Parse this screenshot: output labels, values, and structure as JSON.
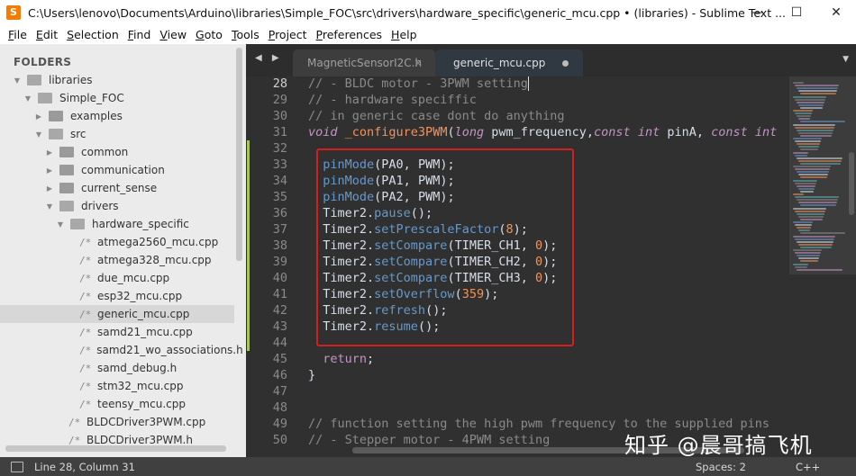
{
  "window": {
    "title": "C:\\Users\\lenovo\\Documents\\Arduino\\libraries\\Simple_FOC\\src\\drivers\\hardware_specific\\generic_mcu.cpp • (libraries) - Sublime Text ...",
    "minimize": "—",
    "maximize": "☐",
    "close": "✕",
    "app_icon": "S"
  },
  "menu": [
    "File",
    "Edit",
    "Selection",
    "Find",
    "View",
    "Goto",
    "Tools",
    "Project",
    "Preferences",
    "Help"
  ],
  "sidebar": {
    "title": "FOLDERS",
    "items": [
      {
        "label": "libraries",
        "kind": "folder",
        "open": true,
        "depth": 1
      },
      {
        "label": "Simple_FOC",
        "kind": "folder",
        "open": true,
        "depth": 2
      },
      {
        "label": "examples",
        "kind": "folder",
        "open": false,
        "depth": 3
      },
      {
        "label": "src",
        "kind": "folder",
        "open": true,
        "depth": 3
      },
      {
        "label": "common",
        "kind": "folder",
        "open": false,
        "depth": 4
      },
      {
        "label": "communication",
        "kind": "folder",
        "open": false,
        "depth": 4
      },
      {
        "label": "current_sense",
        "kind": "folder",
        "open": false,
        "depth": 4
      },
      {
        "label": "drivers",
        "kind": "folder",
        "open": true,
        "depth": 4
      },
      {
        "label": "hardware_specific",
        "kind": "folder",
        "open": true,
        "depth": 5
      },
      {
        "label": "atmega2560_mcu.cpp",
        "kind": "file",
        "depth": 6
      },
      {
        "label": "atmega328_mcu.cpp",
        "kind": "file",
        "depth": 6
      },
      {
        "label": "due_mcu.cpp",
        "kind": "file",
        "depth": 6
      },
      {
        "label": "esp32_mcu.cpp",
        "kind": "file",
        "depth": 6
      },
      {
        "label": "generic_mcu.cpp",
        "kind": "file",
        "depth": 6,
        "selected": true
      },
      {
        "label": "samd21_mcu.cpp",
        "kind": "file",
        "depth": 6
      },
      {
        "label": "samd21_wo_associations.h",
        "kind": "file",
        "depth": 6
      },
      {
        "label": "samd_debug.h",
        "kind": "file",
        "depth": 6
      },
      {
        "label": "stm32_mcu.cpp",
        "kind": "file",
        "depth": 6
      },
      {
        "label": "teensy_mcu.cpp",
        "kind": "file",
        "depth": 6
      },
      {
        "label": "BLDCDriver3PWM.cpp",
        "kind": "file",
        "depth": 5
      },
      {
        "label": "BLDCDriver3PWM.h",
        "kind": "file",
        "depth": 5
      }
    ],
    "file_glyph": "/*"
  },
  "tabs": {
    "nav": "◀ ▶",
    "items": [
      {
        "label": "MagneticSensorI2C.h",
        "active": false,
        "close": "×"
      },
      {
        "label": "generic_mcu.cpp",
        "active": true
      }
    ],
    "dropdown": "▼"
  },
  "editor": {
    "lines": [
      {
        "n": "28",
        "tokens": [
          [
            "c-comment",
            "// - BLDC motor - 3PWM setting"
          ]
        ],
        "cursor": true
      },
      {
        "n": "29",
        "tokens": [
          [
            "c-comment",
            "// - hardware speciffic"
          ]
        ]
      },
      {
        "n": "30",
        "tokens": [
          [
            "c-comment",
            "// in generic case dont do anything"
          ]
        ]
      },
      {
        "n": "31",
        "tokens": [
          [
            "c-type",
            "void"
          ],
          [
            "c-fn",
            " "
          ],
          [
            "c-func",
            "_configure3PWM"
          ],
          [
            "c-fn",
            "("
          ],
          [
            "c-type",
            "long"
          ],
          [
            "c-fn",
            " pwm_frequency,"
          ],
          [
            "c-type",
            "const"
          ],
          [
            "c-fn",
            " "
          ],
          [
            "c-type",
            "int"
          ],
          [
            "c-fn",
            " pinA, "
          ],
          [
            "c-type",
            "const"
          ],
          [
            "c-fn",
            " "
          ],
          [
            "c-type",
            "int"
          ]
        ]
      },
      {
        "n": "32",
        "tokens": [
          [
            "c-fn",
            ""
          ]
        ]
      },
      {
        "n": "33",
        "tokens": [
          [
            "c-fn",
            "  "
          ],
          [
            "c-call",
            "pinMode"
          ],
          [
            "c-fn",
            "(PA0, PWM);"
          ]
        ]
      },
      {
        "n": "34",
        "tokens": [
          [
            "c-fn",
            "  "
          ],
          [
            "c-call",
            "pinMode"
          ],
          [
            "c-fn",
            "(PA1, PWM);"
          ]
        ]
      },
      {
        "n": "35",
        "tokens": [
          [
            "c-fn",
            "  "
          ],
          [
            "c-call",
            "pinMode"
          ],
          [
            "c-fn",
            "(PA2, PWM);"
          ]
        ]
      },
      {
        "n": "36",
        "tokens": [
          [
            "c-fn",
            "  Timer2."
          ],
          [
            "c-call",
            "pause"
          ],
          [
            "c-fn",
            "();"
          ]
        ]
      },
      {
        "n": "37",
        "tokens": [
          [
            "c-fn",
            "  Timer2."
          ],
          [
            "c-call",
            "setPrescaleFactor"
          ],
          [
            "c-fn",
            "("
          ],
          [
            "c-num",
            "8"
          ],
          [
            "c-fn",
            ");"
          ]
        ]
      },
      {
        "n": "38",
        "tokens": [
          [
            "c-fn",
            "  Timer2."
          ],
          [
            "c-call",
            "setCompare"
          ],
          [
            "c-fn",
            "(TIMER_CH1, "
          ],
          [
            "c-num",
            "0"
          ],
          [
            "c-fn",
            ");"
          ]
        ]
      },
      {
        "n": "39",
        "tokens": [
          [
            "c-fn",
            "  Timer2."
          ],
          [
            "c-call",
            "setCompare"
          ],
          [
            "c-fn",
            "(TIMER_CH2, "
          ],
          [
            "c-num",
            "0"
          ],
          [
            "c-fn",
            ");"
          ]
        ]
      },
      {
        "n": "40",
        "tokens": [
          [
            "c-fn",
            "  Timer2."
          ],
          [
            "c-call",
            "setCompare"
          ],
          [
            "c-fn",
            "(TIMER_CH3, "
          ],
          [
            "c-num",
            "0"
          ],
          [
            "c-fn",
            ");"
          ]
        ]
      },
      {
        "n": "41",
        "tokens": [
          [
            "c-fn",
            "  Timer2."
          ],
          [
            "c-call",
            "setOverflow"
          ],
          [
            "c-fn",
            "("
          ],
          [
            "c-num",
            "359"
          ],
          [
            "c-fn",
            ");"
          ]
        ]
      },
      {
        "n": "42",
        "tokens": [
          [
            "c-fn",
            "  Timer2."
          ],
          [
            "c-call",
            "refresh"
          ],
          [
            "c-fn",
            "();"
          ]
        ]
      },
      {
        "n": "43",
        "tokens": [
          [
            "c-fn",
            "  Timer2."
          ],
          [
            "c-call",
            "resume"
          ],
          [
            "c-fn",
            "();"
          ]
        ]
      },
      {
        "n": "44",
        "tokens": [
          [
            "c-fn",
            ""
          ]
        ]
      },
      {
        "n": "45",
        "tokens": [
          [
            "c-fn",
            "  "
          ],
          [
            "c-ret",
            "return"
          ],
          [
            "c-fn",
            ";"
          ]
        ]
      },
      {
        "n": "46",
        "tokens": [
          [
            "c-fn",
            "}"
          ]
        ]
      },
      {
        "n": "47",
        "tokens": [
          [
            "c-fn",
            ""
          ]
        ]
      },
      {
        "n": "48",
        "tokens": [
          [
            "c-fn",
            ""
          ]
        ]
      },
      {
        "n": "49",
        "tokens": [
          [
            "c-comment",
            "// function setting the high pwm frequency to the supplied pins"
          ]
        ]
      },
      {
        "n": "50",
        "tokens": [
          [
            "c-comment",
            "// - Stepper motor - 4PWM setting"
          ]
        ]
      }
    ],
    "modified_lines": [
      "32",
      "44"
    ]
  },
  "watermark": "知乎 @晨哥搞飞机",
  "status": {
    "position": "Line 28, Column 31",
    "spaces": "Spaces: 2",
    "syntax": "C++"
  },
  "colors": {
    "editor_bg": "#303030",
    "highlight_box": "#d41f1f",
    "modified_marker": "#a7c65a"
  }
}
